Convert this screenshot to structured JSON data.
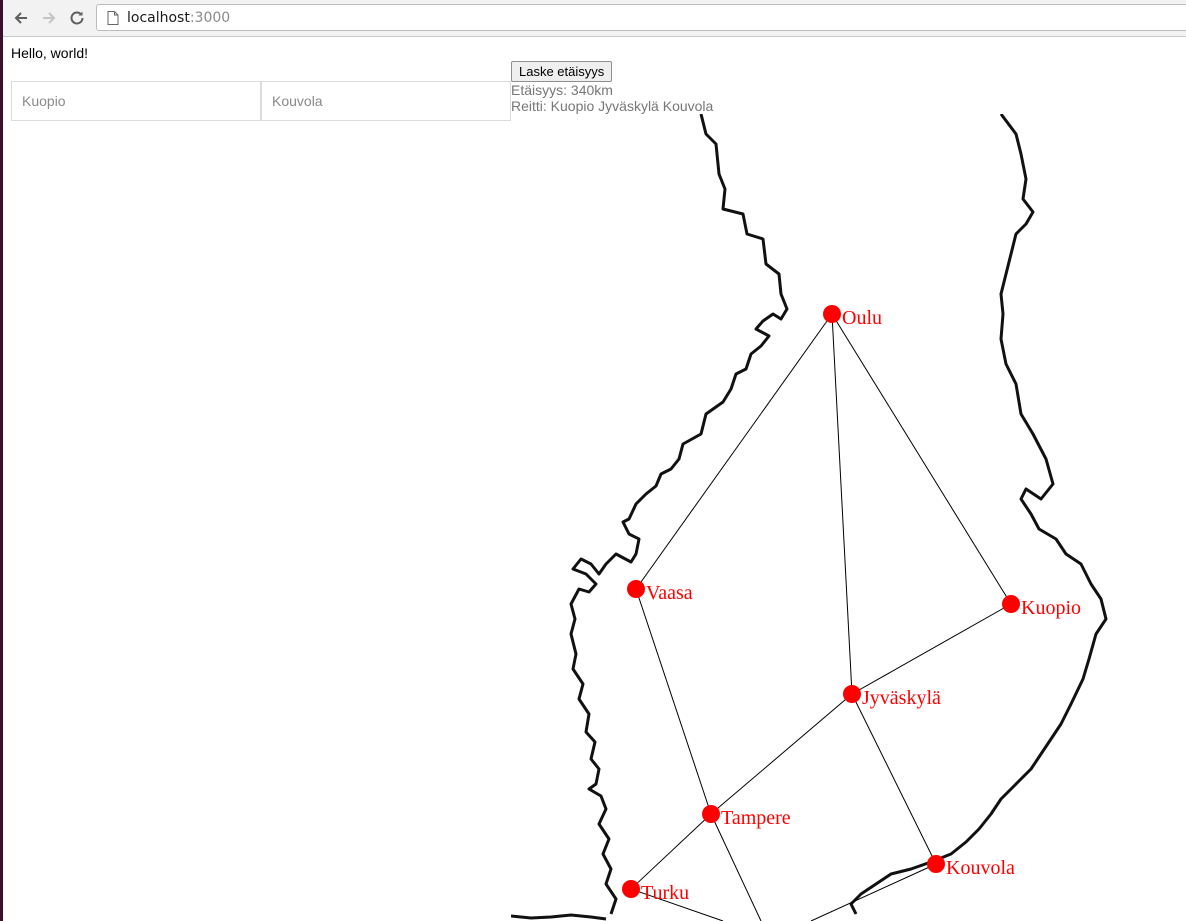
{
  "browser": {
    "url_host": "localhost",
    "url_port": ":3000"
  },
  "page": {
    "greeting": "Hello, world!",
    "from_placeholder": "Kuopio",
    "to_placeholder": "Kouvola",
    "calc_button": "Laske etäisyys",
    "distance_text": "Etäisyys: 340km",
    "route_text": "Reitti: Kuopio Jyväskylä Kouvola"
  },
  "map": {
    "node_color": "#ff0000",
    "edge_color": "#000000",
    "cities": [
      {
        "name": "Oulu"
      },
      {
        "name": "Vaasa"
      },
      {
        "name": "Kuopio"
      },
      {
        "name": "Jyväskylä"
      },
      {
        "name": "Tampere"
      },
      {
        "name": "Kouvola"
      },
      {
        "name": "Turku"
      }
    ]
  }
}
